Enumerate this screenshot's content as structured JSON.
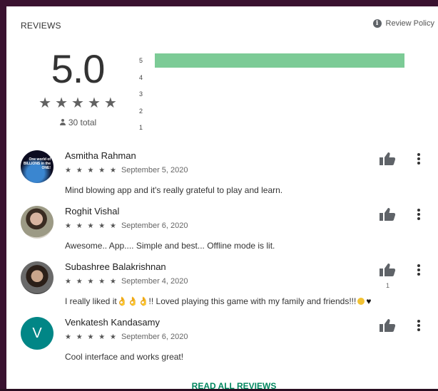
{
  "header": {
    "title": "REVIEWS",
    "policy_label": "Review Policy",
    "policy_icon": "info-icon"
  },
  "summary": {
    "average": "5.0",
    "stars": "★★★★★",
    "total": "30 total"
  },
  "histogram": {
    "rows": [
      {
        "label": "5",
        "fraction": 1.0
      },
      {
        "label": "4",
        "fraction": 0.0
      },
      {
        "label": "3",
        "fraction": 0.0
      },
      {
        "label": "2",
        "fraction": 0.0
      },
      {
        "label": "1",
        "fraction": 0.0
      }
    ],
    "bar_color": "#7ccb96"
  },
  "reviews": [
    {
      "name": "Asmitha Rahman",
      "rating": "★ ★ ★ ★ ★",
      "date": "September 5, 2020",
      "text": "Mind blowing app and it's really grateful to play and learn.",
      "avatar_text": "One world of BILLIONS in the ONE!",
      "likes": ""
    },
    {
      "name": "Roghit Vishal",
      "rating": "★ ★ ★ ★ ★",
      "date": "September 6, 2020",
      "text": "Awesome.. App.... Simple and best... Offline mode is lit.",
      "avatar_text": "",
      "likes": ""
    },
    {
      "name": "Subashree Balakrishnan",
      "rating": "★ ★ ★ ★ ★",
      "date": "September 4, 2020",
      "text": "I really liked it👌👌👌!! Loved playing this game with my family and friends!!!",
      "avatar_text": "",
      "likes": "1"
    },
    {
      "name": "Venkatesh Kandasamy",
      "rating": "★ ★ ★ ★ ★",
      "date": "September 6, 2020",
      "text": "Cool interface and works great!",
      "avatar_text": "V",
      "likes": ""
    }
  ],
  "footer": {
    "read_all": "READ ALL REVIEWS"
  }
}
